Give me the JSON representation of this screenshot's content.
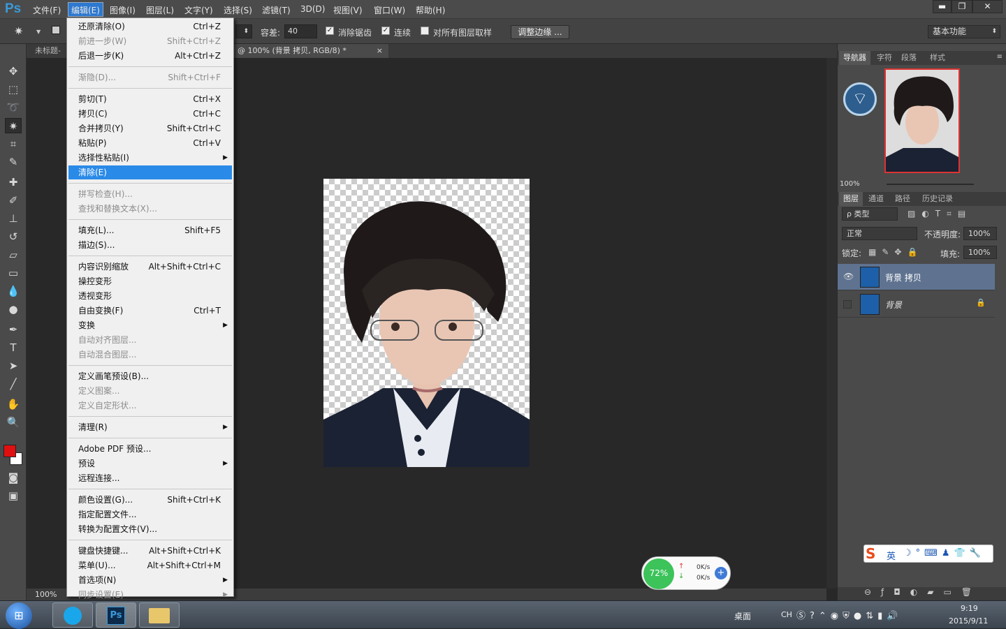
{
  "app": {
    "logo": "Ps"
  },
  "menubar": {
    "items": [
      "文件(F)",
      "编辑(E)",
      "图像(I)",
      "图层(L)",
      "文字(Y)",
      "选择(S)",
      "滤镜(T)",
      "3D(D)",
      "视图(V)",
      "窗口(W)",
      "帮助(H)"
    ],
    "window_buttons": [
      "▬",
      "❐",
      "✕"
    ]
  },
  "options": {
    "tolerance_label": "容差:",
    "tolerance_value": "40",
    "antialias_label": "消除锯齿",
    "contiguous_label": "连续",
    "sample_all_label": "对所有图层取样",
    "refine_edge_label": "调整边缘 ...",
    "workspace": "基本功能"
  },
  "tabs": {
    "untitled": "未标题-",
    "document": "@ 100% (背景 拷贝, RGB/8) *",
    "close": "×"
  },
  "statusbar": {
    "zoom": "100%"
  },
  "edit_menu": {
    "items": [
      {
        "label": "还原清除(O)",
        "shortcut": "Ctrl+Z",
        "disabled": false
      },
      {
        "label": "前进一步(W)",
        "shortcut": "Shift+Ctrl+Z",
        "disabled": true
      },
      {
        "label": "后退一步(K)",
        "shortcut": "Alt+Ctrl+Z",
        "disabled": false
      },
      {
        "label": "渐隐(D)...",
        "shortcut": "Shift+Ctrl+F",
        "disabled": true
      },
      {
        "label": "剪切(T)",
        "shortcut": "Ctrl+X",
        "disabled": false
      },
      {
        "label": "拷贝(C)",
        "shortcut": "Ctrl+C",
        "disabled": false
      },
      {
        "label": "合并拷贝(Y)",
        "shortcut": "Shift+Ctrl+C",
        "disabled": false
      },
      {
        "label": "粘贴(P)",
        "shortcut": "Ctrl+V",
        "disabled": false
      },
      {
        "label": "选择性粘贴(I)",
        "shortcut": "",
        "submenu": true,
        "disabled": false
      },
      {
        "label": "清除(E)",
        "shortcut": "",
        "disabled": false,
        "highlighted": true
      },
      {
        "label": "拼写检查(H)...",
        "shortcut": "",
        "disabled": true
      },
      {
        "label": "查找和替换文本(X)...",
        "shortcut": "",
        "disabled": true
      },
      {
        "label": "填充(L)...",
        "shortcut": "Shift+F5",
        "disabled": false
      },
      {
        "label": "描边(S)...",
        "shortcut": "",
        "disabled": false
      },
      {
        "label": "内容识别缩放",
        "shortcut": "Alt+Shift+Ctrl+C",
        "disabled": false
      },
      {
        "label": "操控变形",
        "shortcut": "",
        "disabled": false
      },
      {
        "label": "透视变形",
        "shortcut": "",
        "disabled": false
      },
      {
        "label": "自由变换(F)",
        "shortcut": "Ctrl+T",
        "disabled": false
      },
      {
        "label": "变换",
        "shortcut": "",
        "submenu": true,
        "disabled": false
      },
      {
        "label": "自动对齐图层...",
        "shortcut": "",
        "disabled": true
      },
      {
        "label": "自动混合图层...",
        "shortcut": "",
        "disabled": true
      },
      {
        "label": "定义画笔预设(B)...",
        "shortcut": "",
        "disabled": false
      },
      {
        "label": "定义图案...",
        "shortcut": "",
        "disabled": true
      },
      {
        "label": "定义自定形状...",
        "shortcut": "",
        "disabled": true
      },
      {
        "label": "清理(R)",
        "shortcut": "",
        "submenu": true,
        "disabled": false
      },
      {
        "label": "Adobe PDF 预设...",
        "shortcut": "",
        "disabled": false
      },
      {
        "label": "预设",
        "shortcut": "",
        "submenu": true,
        "disabled": false
      },
      {
        "label": "远程连接...",
        "shortcut": "",
        "disabled": false
      },
      {
        "label": "颜色设置(G)...",
        "shortcut": "Shift+Ctrl+K",
        "disabled": false
      },
      {
        "label": "指定配置文件...",
        "shortcut": "",
        "disabled": false
      },
      {
        "label": "转换为配置文件(V)...",
        "shortcut": "",
        "disabled": false
      },
      {
        "label": "键盘快捷键...",
        "shortcut": "Alt+Shift+Ctrl+K",
        "disabled": false
      },
      {
        "label": "菜单(U)...",
        "shortcut": "Alt+Shift+Ctrl+M",
        "disabled": false
      },
      {
        "label": "首选项(N)",
        "shortcut": "",
        "submenu": true,
        "disabled": false
      },
      {
        "label": "同步设置(E)",
        "shortcut": "",
        "submenu": true,
        "disabled": true
      }
    ]
  },
  "navigator": {
    "tabs": [
      "导航器",
      "字符",
      "段落",
      "样式"
    ],
    "zoom": "100%"
  },
  "layers_panel": {
    "tabs": [
      "图层",
      "通道",
      "路径",
      "历史记录"
    ],
    "filter_kind": "ρ 类型",
    "blend_mode": "正常",
    "opacity_label": "不透明度:",
    "opacity_value": "100%",
    "lock_label": "锁定:",
    "fill_label": "填充:",
    "fill_value": "100%",
    "layers": [
      {
        "name": "背景 拷贝",
        "visible": true,
        "selected": true,
        "locked": false
      },
      {
        "name": "背景",
        "visible": false,
        "selected": false,
        "locked": true
      }
    ]
  },
  "ime_bar": {
    "mode": "英"
  },
  "net_widget": {
    "percent": "72%",
    "up": "0K/s",
    "down": "0K/s"
  },
  "taskbar": {
    "desktop_label": "桌面",
    "lang": "CH",
    "time": "9:19",
    "date": "2015/9/11"
  },
  "colors": {
    "foreground": "#e01010",
    "background": "#ffffff",
    "highlight": "#2a8ae8"
  }
}
